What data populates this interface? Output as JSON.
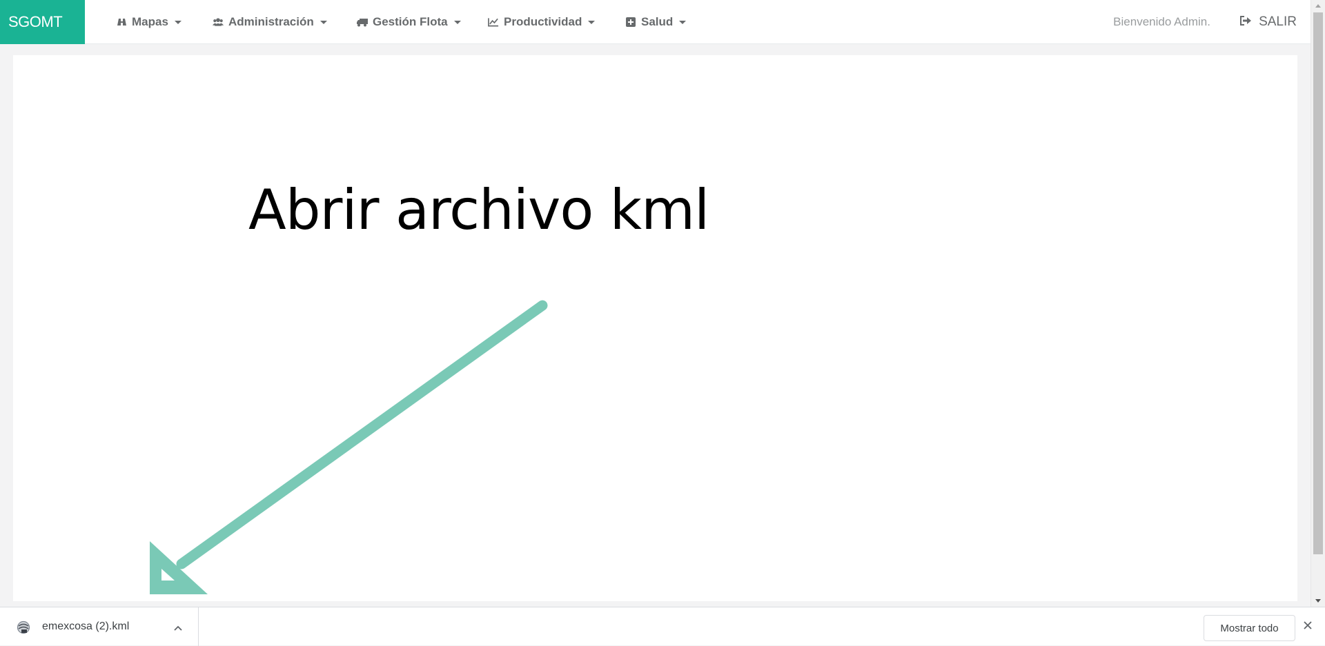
{
  "brand": {
    "name": "SGOMT",
    "color": "#1ab394"
  },
  "nav": {
    "items": [
      {
        "label": "Mapas",
        "icon": "binoculars-icon"
      },
      {
        "label": "Administración",
        "icon": "users-icon"
      },
      {
        "label": "Gestión Flota",
        "icon": "truck-icon"
      },
      {
        "label": "Productividad",
        "icon": "line-chart-icon"
      },
      {
        "label": "Salud",
        "icon": "plus-square-icon"
      }
    ],
    "welcome": "Bienvenido Admin.",
    "logout_label": "SALIR",
    "logout_icon": "sign-out-icon"
  },
  "main": {
    "headline": "Abrir archivo kml",
    "arrow_color": "#7ac9b6"
  },
  "download_bar": {
    "file_name": "emexcosa (2).kml",
    "file_icon": "kml-file-icon",
    "show_all_label": "Mostrar todo"
  }
}
